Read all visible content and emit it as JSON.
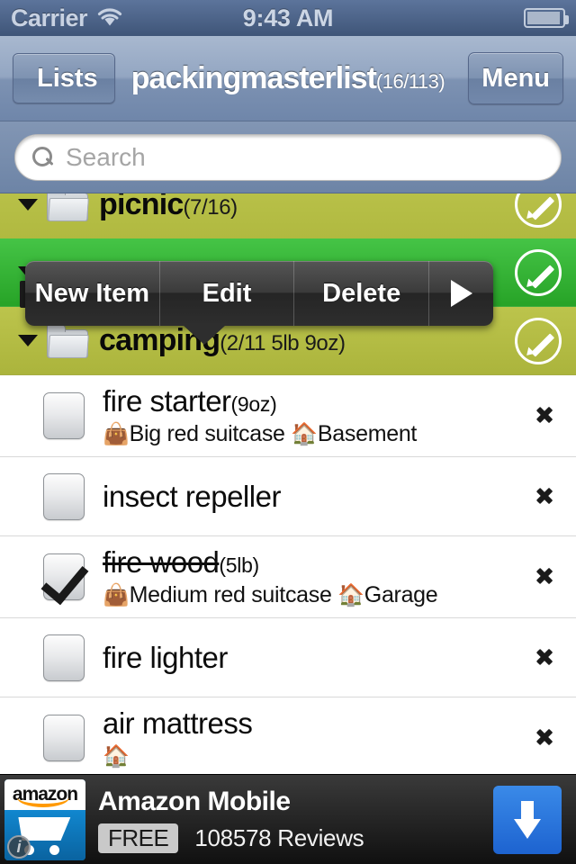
{
  "status_bar": {
    "carrier": "Carrier",
    "wifi_icon": "wifi-icon",
    "time": "9:43 AM",
    "battery_icon": "battery-icon"
  },
  "nav_bar": {
    "back_label": "Lists",
    "title": "packingmasterlist",
    "title_count": "(16/113)",
    "menu_label": "Menu"
  },
  "search": {
    "placeholder": "Search",
    "value": "",
    "icon": "search-icon"
  },
  "colors": {
    "olive_row": "#b0b940",
    "green_selected_row": "#2fb02f",
    "navbar": "#7d92b2",
    "ad_accent": "#1d63d0"
  },
  "context_menu": {
    "items": [
      {
        "label": "New Item"
      },
      {
        "label": "Edit"
      },
      {
        "label": "Delete"
      }
    ],
    "more_arrow": "play-arrow-icon"
  },
  "list": {
    "clipped_folder": {
      "name": "picnic",
      "meta": "(7/16)"
    },
    "folders": [
      {
        "name": "camping",
        "meta": "(2/11 5lb 9oz)",
        "expanded": true,
        "twisty_icon": "chevron-down-icon",
        "folder_icon": "folder-icon",
        "edit_icon": "pencil-circle-icon"
      }
    ],
    "items": [
      {
        "name": "fire starter",
        "qty": "(9oz)",
        "checked": false,
        "bag_emoji": "👜",
        "bag": "Big red suitcase",
        "place_emoji": "🏠",
        "place": "Basement",
        "disclosure_icon": "chevron-right-icon"
      },
      {
        "name": "insect repeller",
        "qty": "",
        "checked": false,
        "bag_emoji": "",
        "bag": "",
        "place_emoji": "",
        "place": "",
        "disclosure_icon": "chevron-right-icon"
      },
      {
        "name": "fire wood",
        "qty": "(5lb)",
        "checked": true,
        "bag_emoji": "👜",
        "bag": "Medium red suitcase",
        "place_emoji": "🏠",
        "place": "Garage",
        "disclosure_icon": "chevron-right-icon"
      },
      {
        "name": "fire lighter",
        "qty": "",
        "checked": false,
        "bag_emoji": "",
        "bag": "",
        "place_emoji": "",
        "place": "",
        "disclosure_icon": "chevron-right-icon"
      },
      {
        "name": "air mattress",
        "qty": "",
        "checked": false,
        "bag_emoji": "",
        "bag": "",
        "place_emoji": "🏠",
        "place": "",
        "disclosure_icon": "chevron-right-icon"
      }
    ]
  },
  "ad": {
    "brand": "amazon",
    "title": "Amazon Mobile",
    "price_badge": "FREE",
    "reviews": "108578 Reviews",
    "info_glyph": "i",
    "download_icon": "download-arrow-icon"
  }
}
